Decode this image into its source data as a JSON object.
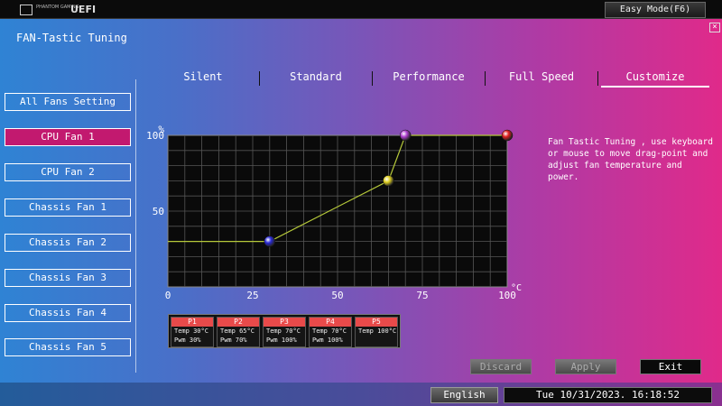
{
  "topbar": {
    "brand_small": "PHANTOM GAMING",
    "uefi": "UEFI",
    "easy_mode": "Easy Mode(F6)"
  },
  "page": {
    "title": "FAN-Tastic Tuning",
    "close_glyph": "×"
  },
  "sidebar": {
    "items": [
      {
        "label": "All Fans Setting",
        "active": false
      },
      {
        "label": "CPU Fan 1",
        "active": true
      },
      {
        "label": "CPU Fan 2",
        "active": false
      },
      {
        "label": "Chassis Fan 1",
        "active": false
      },
      {
        "label": "Chassis Fan 2",
        "active": false
      },
      {
        "label": "Chassis Fan 3",
        "active": false
      },
      {
        "label": "Chassis Fan 4",
        "active": false
      },
      {
        "label": "Chassis Fan 5",
        "active": false
      }
    ]
  },
  "tabs": [
    {
      "label": "Silent",
      "active": false
    },
    {
      "label": "Standard",
      "active": false
    },
    {
      "label": "Performance",
      "active": false
    },
    {
      "label": "Full Speed",
      "active": false
    },
    {
      "label": "Customize",
      "active": true
    }
  ],
  "description": "Fan Tastic Tuning , use keyboard or mouse to move drag-point and adjust fan temperature and power.",
  "chart_data": {
    "type": "line",
    "ylabel": "%",
    "xlabel": "°C",
    "xlim": [
      0,
      100
    ],
    "ylim": [
      0,
      100
    ],
    "x_ticks": [
      0,
      25,
      50,
      75,
      100
    ],
    "y_ticks": [
      50,
      100
    ],
    "grid": true,
    "points": [
      {
        "name": "P1",
        "x": 30,
        "y": 30,
        "color": "#2a2ad8"
      },
      {
        "name": "P2",
        "x": 65,
        "y": 70,
        "color": "#e0d020"
      },
      {
        "name": "P3",
        "x": 70,
        "y": 100,
        "color": "#b040d0"
      },
      {
        "name": "P5",
        "x": 100,
        "y": 100,
        "color": "#e02020"
      }
    ],
    "line_color": "#b5c83a"
  },
  "point_table": [
    {
      "name": "P1",
      "temp": "Temp 30°C",
      "pwm": "Pwm  30%"
    },
    {
      "name": "P2",
      "temp": "Temp 65°C",
      "pwm": "Pwm  70%"
    },
    {
      "name": "P3",
      "temp": "Temp 70°C",
      "pwm": "Pwm  100%"
    },
    {
      "name": "P4",
      "temp": "Temp 70°C",
      "pwm": "Pwm  100%"
    },
    {
      "name": "P5",
      "temp": "Temp 100°C",
      "pwm": ""
    }
  ],
  "actions": {
    "discard": "Discard",
    "apply": "Apply",
    "exit": "Exit"
  },
  "status": {
    "language": "English",
    "datetime": "Tue 10/31/2023. 16:18:52"
  },
  "colors": {
    "active_fan": "#c2196f",
    "header_red": "#e84a4a"
  }
}
